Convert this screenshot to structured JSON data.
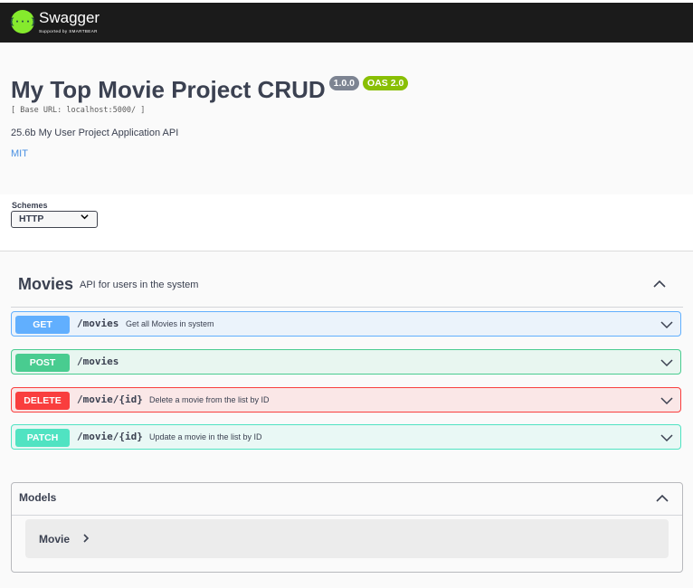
{
  "topbar": {
    "logo_glyph": "{···}",
    "brand": "Swagger",
    "sub": "Supported by SMARTBEAR"
  },
  "info": {
    "title": "My Top Movie Project CRUD",
    "version": "1.0.0",
    "oas": "OAS 2.0",
    "base_url": "[ Base URL: localhost:5000/ ]",
    "description": "25.6b My User Project Application API",
    "license": "MIT"
  },
  "schemes": {
    "label": "Schemes",
    "selected": "HTTP"
  },
  "tag": {
    "name": "Movies",
    "description": "API for users in the system"
  },
  "operations": [
    {
      "method": "GET",
      "path": "/movies",
      "summary": "Get all Movies in system"
    },
    {
      "method": "POST",
      "path": "/movies",
      "summary": ""
    },
    {
      "method": "DELETE",
      "path": "/movie/{id}",
      "summary": "Delete a movie from the list by ID"
    },
    {
      "method": "PATCH",
      "path": "/movie/{id}",
      "summary": "Update a movie in the list by ID"
    }
  ],
  "models": {
    "title": "Models",
    "items": [
      {
        "name": "Movie"
      }
    ]
  },
  "colors": {
    "get": "#61affe",
    "post": "#49cc90",
    "delete": "#f93e3e",
    "patch": "#50e3c2",
    "topbar": "#1b1b1b",
    "logo": "#85ea2d"
  }
}
